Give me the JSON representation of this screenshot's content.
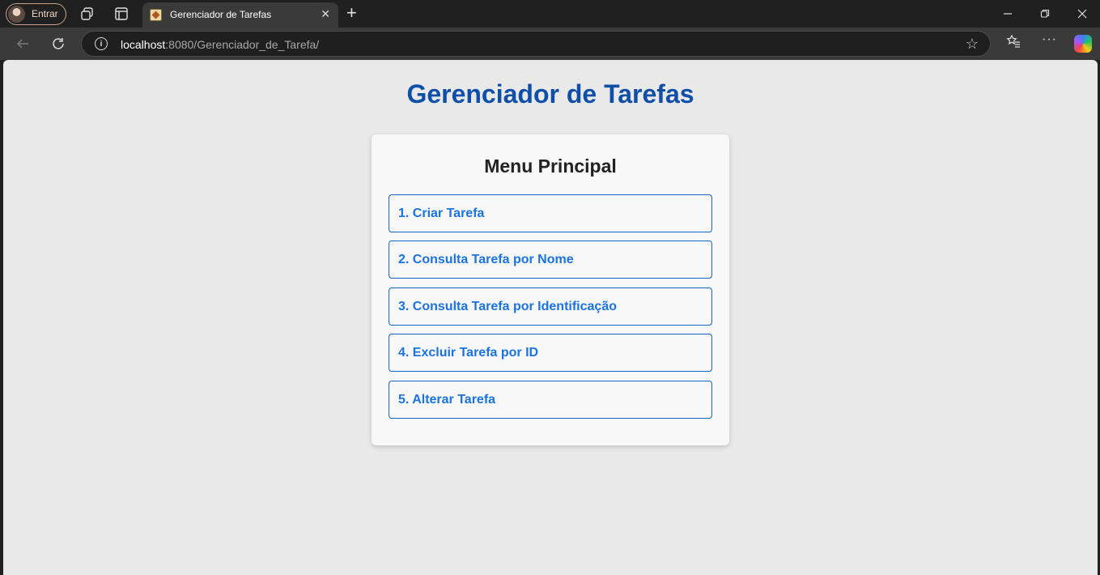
{
  "browser": {
    "profile_label": "Entrar",
    "tab_title": "Gerenciador de Tarefas",
    "url_host": "localhost",
    "url_rest": ":8080/Gerenciador_de_Tarefa/"
  },
  "page": {
    "title": "Gerenciador de Tarefas",
    "menu": {
      "title": "Menu Principal",
      "items": [
        {
          "label": "1. Criar Tarefa"
        },
        {
          "label": "2. Consulta Tarefa por Nome"
        },
        {
          "label": "3. Consulta Tarefa por Identificação"
        },
        {
          "label": "4. Excluir Tarefa por ID"
        },
        {
          "label": "5. Alterar Tarefa"
        }
      ]
    }
  },
  "colors": {
    "title": "#0f4fa8",
    "menu_text": "#1a73e0",
    "menu_border": "#1a63c7",
    "page_bg": "#e9e9e9"
  }
}
